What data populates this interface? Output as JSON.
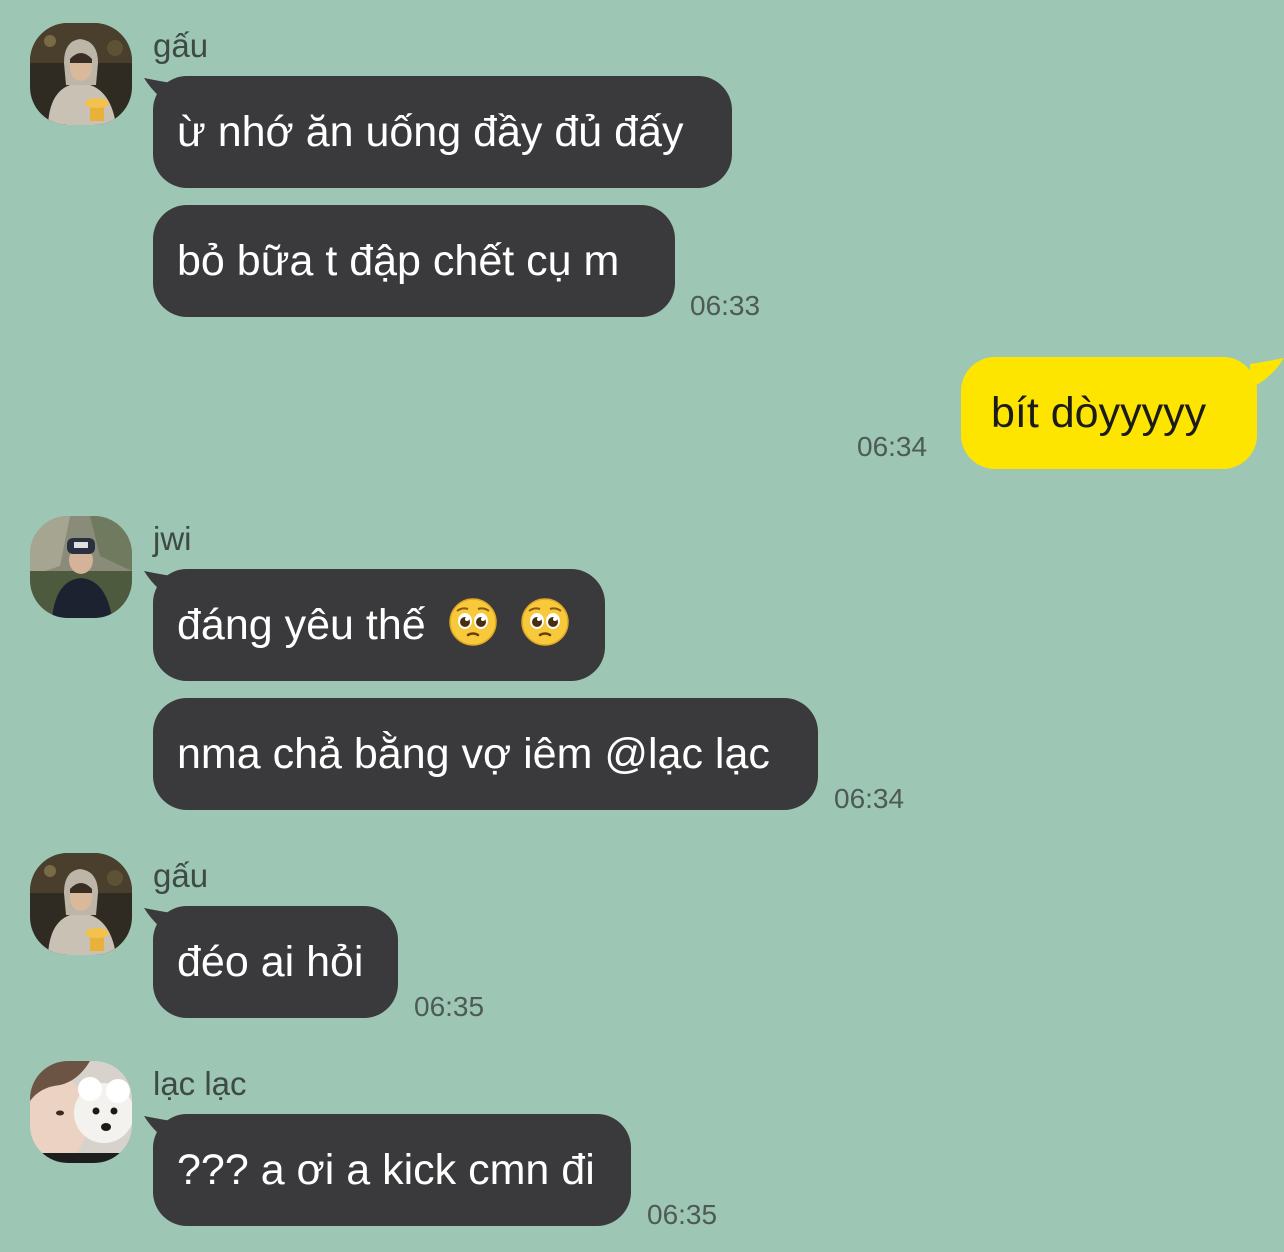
{
  "colors": {
    "background": "#9dc6b5",
    "incoming_bubble": "#3a3a3c",
    "outgoing_bubble": "#fee500"
  },
  "messages": [
    {
      "sender": "gấu",
      "avatar": "gau-avatar",
      "bubbles": [
        "ừ nhớ ăn uống đầy đủ đấy",
        "bỏ bữa t đập chết cụ m"
      ],
      "time": "06:33"
    },
    {
      "outgoing": true,
      "bubbles": [
        "bít dòyyyyy"
      ],
      "time": "06:34"
    },
    {
      "sender": "jwi",
      "avatar": "jwi-avatar",
      "bubbles": [
        "đáng yêu thế",
        "nma chả bằng vợ iêm @lạc lạc"
      ],
      "emoji": [
        "pleading-face-emoji",
        "pleading-face-emoji"
      ],
      "time": "06:34"
    },
    {
      "sender": "gấu",
      "avatar": "gau-avatar",
      "bubbles": [
        "đéo ai hỏi"
      ],
      "time": "06:35"
    },
    {
      "sender": "lạc lạc",
      "avatar": "lac-lac-avatar",
      "bubbles": [
        "??? a ơi a kick cmn đi"
      ],
      "time": "06:35"
    }
  ]
}
